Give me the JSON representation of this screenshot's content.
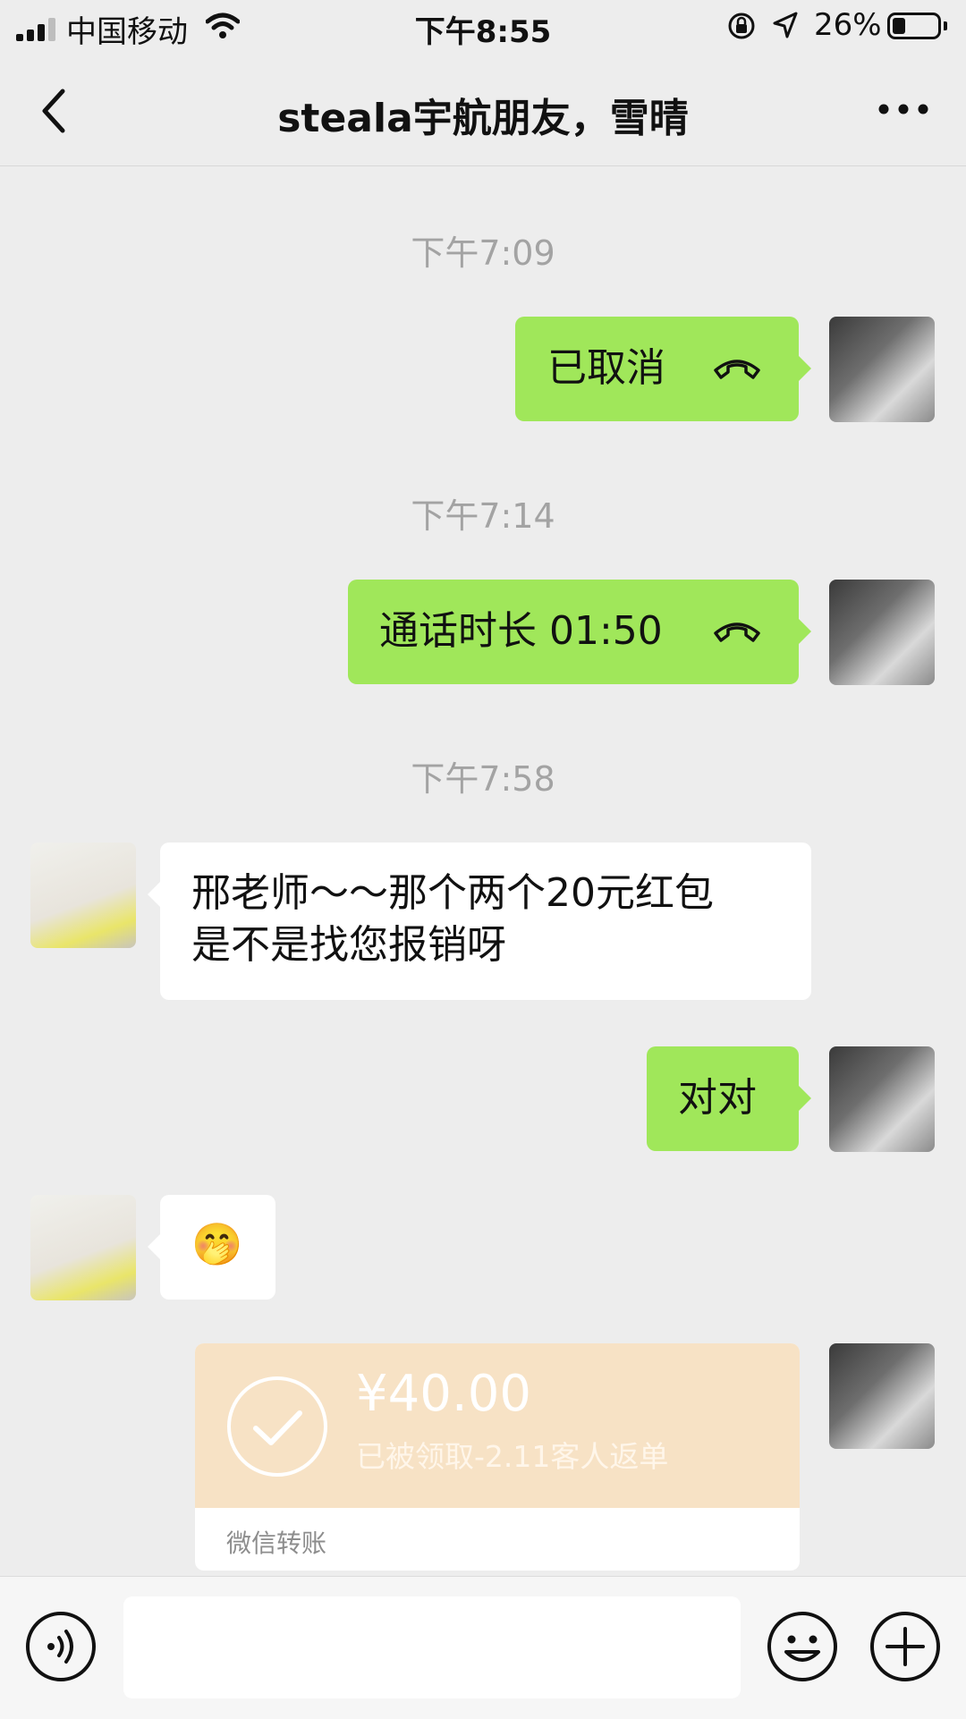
{
  "status_bar": {
    "carrier": "中国移动",
    "time": "下午8:55",
    "battery": "26%"
  },
  "nav": {
    "title": "steala宇航朋友，雪晴"
  },
  "messages": [
    {
      "type": "timestamp",
      "text": "下午7:09"
    },
    {
      "type": "call",
      "from": "me",
      "text": "已取消",
      "icon": "phone-hangup-icon"
    },
    {
      "type": "timestamp",
      "text": "下午7:14"
    },
    {
      "type": "call",
      "from": "me",
      "text": "通话时长 01:50",
      "icon": "phone-hangup-icon"
    },
    {
      "type": "timestamp",
      "text": "下午7:58"
    },
    {
      "type": "text",
      "from": "other",
      "line1": "邢老师～～那个两个20元红包",
      "line2": "是不是找您报销呀"
    },
    {
      "type": "text",
      "from": "me",
      "text": "对对"
    },
    {
      "type": "emoji",
      "from": "other",
      "emoji": "🤭"
    },
    {
      "type": "transfer",
      "from": "me",
      "amount": "¥40.00",
      "status": "已被领取-2.11客人返单",
      "footer": "微信转账",
      "icon": "check-circle-icon"
    }
  ],
  "colors": {
    "background": "#ededed",
    "bubble_me": "#a0e75a",
    "bubble_other": "#ffffff",
    "transfer": "#f7e2c5",
    "timestamp": "#a3a3a3"
  },
  "input_bar": {
    "icons": [
      "voice-icon",
      "emoji-icon",
      "plus-icon"
    ]
  }
}
